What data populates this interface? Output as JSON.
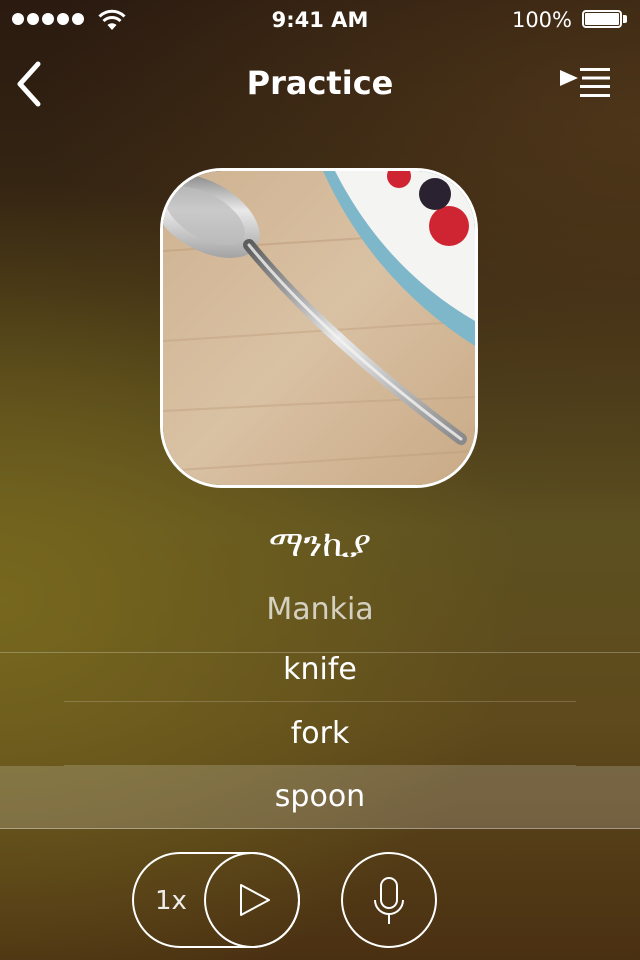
{
  "status_bar": {
    "time": "9:41 AM",
    "battery": "100%"
  },
  "nav": {
    "title": "Practice"
  },
  "card": {
    "image": "spoon-photo"
  },
  "word": {
    "native": "ማንኪያ",
    "transliteration": "Mankia"
  },
  "options": [
    {
      "label": "knife"
    },
    {
      "label": "fork"
    },
    {
      "label": "spoon",
      "selected": true
    }
  ],
  "controls": {
    "speed": "1x"
  },
  "icons": {
    "back": "chevron-left-icon",
    "queue": "play-queue-icon",
    "play": "play-icon",
    "mic": "microphone-icon",
    "wifi": "wifi-icon",
    "battery": "battery-icon"
  }
}
